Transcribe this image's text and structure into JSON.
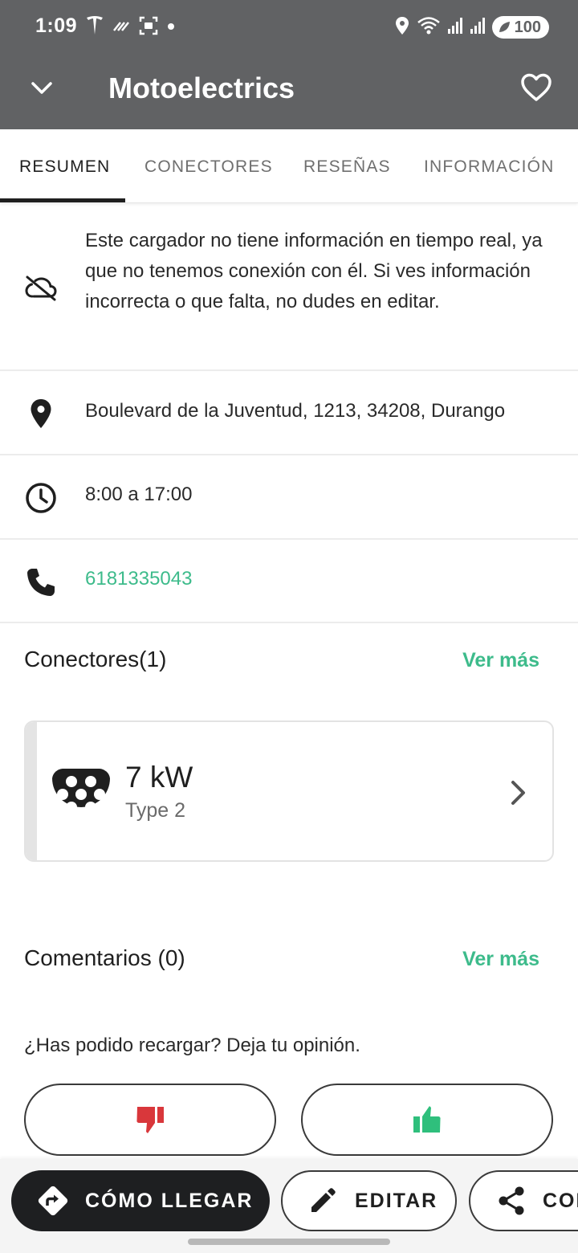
{
  "status_bar": {
    "time": "1:09",
    "battery": "100"
  },
  "app_bar": {
    "title": "Motoelectrics"
  },
  "tabs": [
    {
      "label": "RESUMEN",
      "active": true
    },
    {
      "label": "CONECTORES",
      "active": false
    },
    {
      "label": "RESEÑAS",
      "active": false
    },
    {
      "label": "INFORMACIÓN",
      "active": false
    }
  ],
  "info": {
    "notice": "Este cargador no tiene información en tiempo real, ya que no tenemos conexión con él. Si ves información incorrecta o que falta, no dudes en editar.",
    "address": "Boulevard de la Juventud, 1213, 34208, Durango",
    "hours": "8:00 a 17:00",
    "phone": "6181335043"
  },
  "connectors": {
    "title": "Conectores(1)",
    "see_more": "Ver más",
    "items": [
      {
        "power": "7 kW",
        "type": "Type 2"
      }
    ]
  },
  "comments": {
    "title": "Comentarios (0)",
    "see_more": "Ver más",
    "prompt": "¿Has podido recargar? Deja tu opinión."
  },
  "actions": {
    "directions": "CÓMO LLEGAR",
    "edit": "EDITAR",
    "share": "COMPARTIR"
  },
  "colors": {
    "header": "#616264",
    "accent_green": "#3dbb8b",
    "thumb_down": "#d9373b",
    "thumb_up": "#2fbf7c",
    "primary_button": "#1e1f21"
  },
  "icons": {
    "back": "chevron-down-icon",
    "favorite": "heart-outline-icon",
    "notice": "cloud-off-icon",
    "address": "location-pin-icon",
    "hours": "clock-icon",
    "phone": "phone-icon",
    "connector": "type2-connector-icon",
    "thumb_down": "thumb-down-icon",
    "thumb_up": "thumb-up-icon",
    "directions": "directions-icon",
    "edit": "pencil-icon",
    "share": "share-icon"
  }
}
